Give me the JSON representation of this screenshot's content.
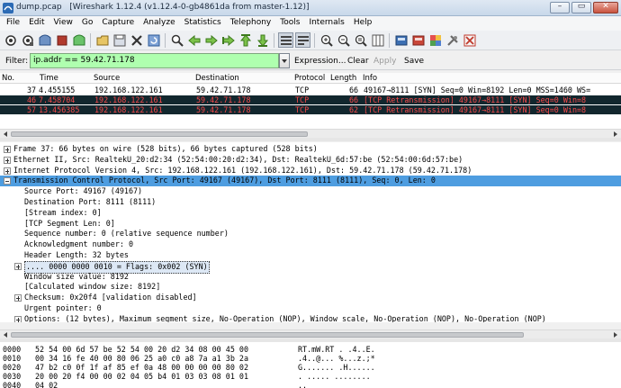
{
  "window": {
    "filename": "dump.pcap",
    "version": "[Wireshark 1.12.4  (v1.12.4-0-gb4861da from master-1.12)]",
    "controls": [
      "–",
      "▭",
      "✕"
    ]
  },
  "menu": [
    "File",
    "Edit",
    "View",
    "Go",
    "Capture",
    "Analyze",
    "Statistics",
    "Telephony",
    "Tools",
    "Internals",
    "Help"
  ],
  "toolbar": {
    "icons": [
      "interface-list-icon",
      "capture-options-icon",
      "start-capture-icon",
      "stop-capture-icon",
      "restart-capture-icon",
      "open-file-icon",
      "save-file-icon",
      "close-file-icon",
      "reload-icon",
      "find-packet-icon",
      "go-back-icon",
      "go-forward-icon",
      "go-to-packet-icon",
      "go-first-icon",
      "go-last-icon",
      "colorize-icon",
      "auto-scroll-icon",
      "zoom-in-icon",
      "zoom-out-icon",
      "zoom-normal-icon",
      "resize-columns-icon",
      "capture-filters-icon",
      "display-filters-icon",
      "coloring-rules-icon",
      "preferences-icon",
      "help-icon"
    ]
  },
  "filter": {
    "label": "Filter:",
    "value": "ip.addr == 59.42.71.178",
    "buttons": [
      "Expression...",
      "Clear",
      "Apply",
      "Save"
    ],
    "color": "#afffaf"
  },
  "packet_list": {
    "columns": [
      "No.",
      "Time",
      "Source",
      "Destination",
      "Protocol",
      "Length",
      "Info"
    ],
    "rows": [
      {
        "no": "37",
        "time": "4.455155",
        "src": "192.168.122.161",
        "dst": "59.42.71.178",
        "proto": "TCP",
        "len": "66",
        "info": "49167→8111 [SYN] Seq=0 Win=8192 Len=0 MSS=1460 WS=",
        "style": "normal"
      },
      {
        "no": "46",
        "time": "7.458704",
        "src": "192.168.122.161",
        "dst": "59.42.71.178",
        "proto": "TCP",
        "len": "66",
        "info": "[TCP Retransmission] 49167→8111 [SYN] Seq=0 Win=8",
        "style": "dark"
      },
      {
        "no": "57",
        "time": "13.456385",
        "src": "192.168.122.161",
        "dst": "59.42.71.178",
        "proto": "TCP",
        "len": "62",
        "info": "[TCP Retransmission] 49167→8111 [SYN] Seq=0 Win=8",
        "style": "dark"
      }
    ]
  },
  "details": [
    {
      "indent": 0,
      "expander": "plus",
      "text": "Frame 37: 66 bytes on wire (528 bits), 66 bytes captured (528 bits)"
    },
    {
      "indent": 0,
      "expander": "plus",
      "text": "Ethernet II, Src: RealtekU_20:d2:34 (52:54:00:20:d2:34), Dst: RealtekU_6d:57:be (52:54:00:6d:57:be)"
    },
    {
      "indent": 0,
      "expander": "plus",
      "text": "Internet Protocol Version 4, Src: 192.168.122.161 (192.168.122.161), Dst: 59.42.71.178 (59.42.71.178)"
    },
    {
      "indent": 0,
      "expander": "minus",
      "text": "Transmission Control Protocol, Src Port: 49167 (49167), Dst Port: 8111 (8111), Seq: 0, Len: 0",
      "highlight": true
    },
    {
      "indent": 1,
      "expander": "",
      "text": "Source Port: 49167 (49167)"
    },
    {
      "indent": 1,
      "expander": "",
      "text": "Destination Port: 8111 (8111)"
    },
    {
      "indent": 1,
      "expander": "",
      "text": "[Stream index: 0]"
    },
    {
      "indent": 1,
      "expander": "",
      "text": "[TCP Segment Len: 0]"
    },
    {
      "indent": 1,
      "expander": "",
      "text": "Sequence number: 0    (relative sequence number)"
    },
    {
      "indent": 1,
      "expander": "",
      "text": "Acknowledgment number: 0"
    },
    {
      "indent": 1,
      "expander": "",
      "text": "Header Length: 32 bytes"
    },
    {
      "indent": 1,
      "expander": "plus",
      "text": ".... 0000 0000 0010 = Flags: 0x002 (SYN)",
      "flags": true
    },
    {
      "indent": 1,
      "expander": "",
      "text": "Window size value: 8192"
    },
    {
      "indent": 1,
      "expander": "",
      "text": "[Calculated window size: 8192]"
    },
    {
      "indent": 1,
      "expander": "plus",
      "text": "Checksum: 0x20f4 [validation disabled]"
    },
    {
      "indent": 1,
      "expander": "",
      "text": "Urgent pointer: 0"
    },
    {
      "indent": 1,
      "expander": "plus",
      "text": "Options: (12 bytes), Maximum segment size, No-Operation (NOP), Window scale, No-Operation (NOP), No-Operation (NOP)"
    }
  ],
  "hex": [
    {
      "offset": "0000",
      "bytes": "52 54 00 6d 57 be 52 54  00 20 d2 34 08 00 45 00",
      "ascii": "RT.mW.RT . .4..E."
    },
    {
      "offset": "0010",
      "bytes": "00 34 16 fe 40 00 80 06  25 a0 c0 a8 7a a1 3b 2a",
      "ascii": ".4..@... %...z.;*"
    },
    {
      "offset": "0020",
      "bytes": "47 b2 c0 0f 1f af 85 ef  0a 48 00 00 00 00 80 02",
      "ascii": "G....... .H......"
    },
    {
      "offset": "0030",
      "bytes": "20 00 20 f4 00 00 02 04  05 b4 01 03 03 08 01 01",
      "ascii": " . .....  ........"
    },
    {
      "offset": "0040",
      "bytes": "04 02",
      "ascii": ".."
    }
  ]
}
